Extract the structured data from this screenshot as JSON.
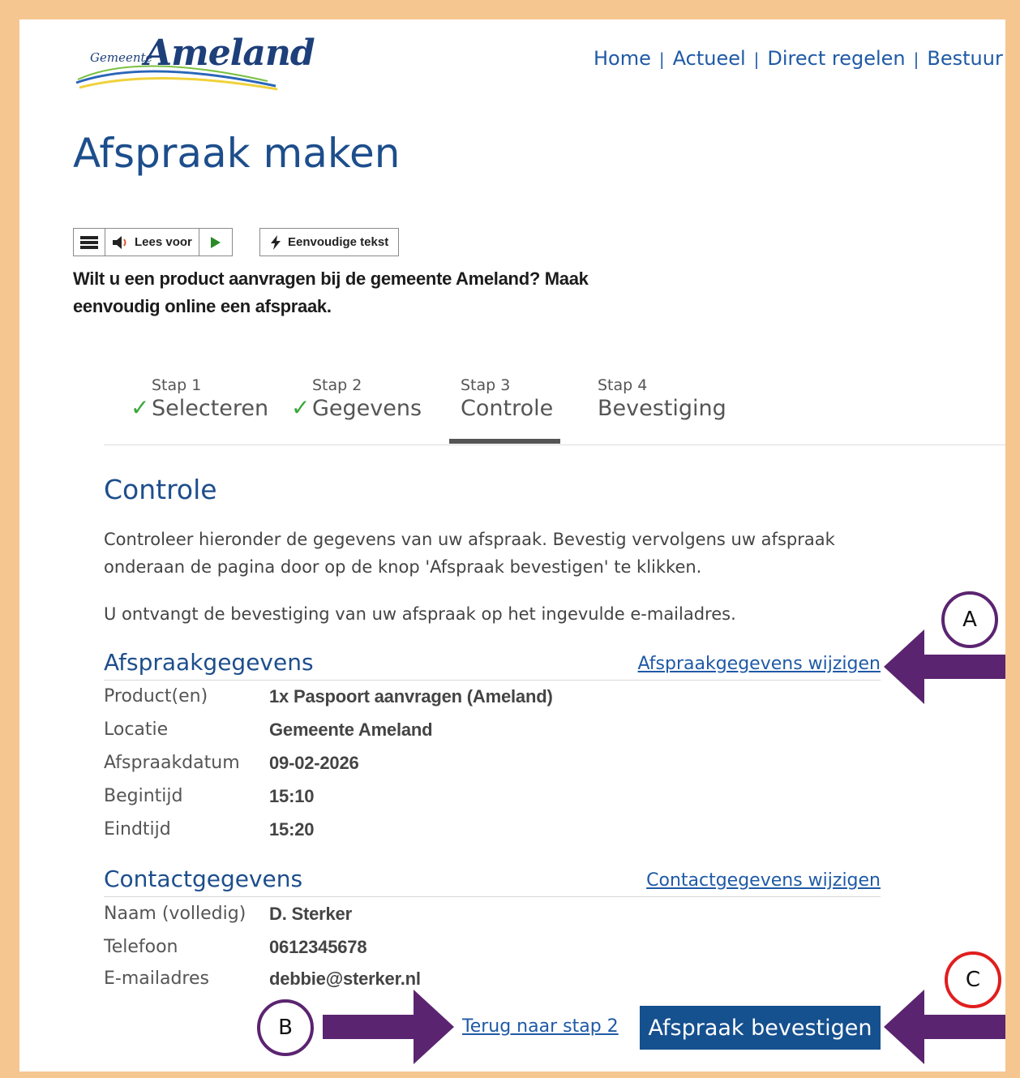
{
  "header": {
    "logo_small": "Gemeente",
    "logo_big": "Ameland",
    "nav": [
      "Home",
      "Actueel",
      "Direct regelen",
      "Bestuur"
    ]
  },
  "page_title": "Afspraak maken",
  "readspeaker": {
    "listen_label": "Lees voor",
    "easy_text_label": "Eenvoudige tekst"
  },
  "intro": "Wilt u een product aanvragen bij de gemeente Ameland? Maak eenvoudig online een afspraak.",
  "steps": [
    {
      "small": "Stap 1",
      "label": "Selecteren",
      "done": true
    },
    {
      "small": "Stap 2",
      "label": "Gegevens",
      "done": true
    },
    {
      "small": "Stap 3",
      "label": "Controle",
      "active": true
    },
    {
      "small": "Stap 4",
      "label": "Bevestiging"
    }
  ],
  "controle": {
    "title": "Controle",
    "desc1": "Controleer hieronder de gegevens van uw afspraak. Bevestig vervolgens uw afspraak onderaan de pagina door op de knop 'Afspraak bevestigen' te klikken.",
    "desc2": "U ontvangt de bevestiging van uw afspraak op het ingevulde e-mailadres."
  },
  "appointment": {
    "title": "Afspraakgegevens",
    "edit_link": "Afspraakgegevens wijzigen",
    "rows": [
      {
        "label": "Product(en)",
        "value": "1x Paspoort aanvragen (Ameland)"
      },
      {
        "label": "Locatie",
        "value": "Gemeente Ameland"
      },
      {
        "label": "Afspraakdatum",
        "value": "09-02-2026"
      },
      {
        "label": "Begintijd",
        "value": "15:10"
      },
      {
        "label": "Eindtijd",
        "value": "15:20"
      }
    ]
  },
  "contact": {
    "title": "Contactgegevens",
    "edit_link": "Contactgegevens wijzigen",
    "rows": [
      {
        "label": "Naam (volledig)",
        "value": "D. Sterker"
      },
      {
        "label": "Telefoon",
        "value": "0612345678"
      },
      {
        "label": "E-mailadres",
        "value": "debbie@sterker.nl"
      }
    ]
  },
  "actions": {
    "back_link": "Terug naar stap 2",
    "confirm_button": "Afspraak bevestigen"
  },
  "annotations": {
    "a": "A",
    "b": "B",
    "c": "C",
    "arrow_color": "#5b2470",
    "circle_c_color": "#e01e1e"
  }
}
